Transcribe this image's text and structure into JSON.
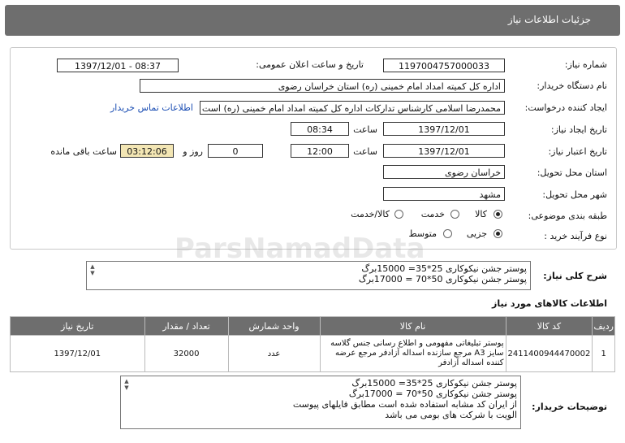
{
  "header": {
    "title": "جزئیات اطلاعات نیاز"
  },
  "form": {
    "need_number_label": "شماره نیاز:",
    "need_number": "1197004757000033",
    "announce_label": "تاریخ و ساعت اعلان عمومی:",
    "announce_value": "1397/12/01 - 08:37",
    "buyer_org_label": "نام دستگاه خریدار:",
    "buyer_org": "اداره کل کمیته امداد امام خمینی (ره) استان خراسان رضوی",
    "creator_label": "ایجاد کننده درخواست:",
    "creator": "محمدرضا اسلامی کارشناس تدارکات اداره کل کمیته امداد امام خمینی (ره) است",
    "contact_link": "اطلاعات تماس خریدار",
    "created_date_label": "تاریخ ایجاد نیاز:",
    "created_date": "1397/12/01",
    "time_label": "ساعت",
    "created_time": "08:34",
    "validity_label": "تاریخ اعتبار نیاز:",
    "validity_date": "1397/12/01",
    "validity_time": "12:00",
    "days_value": "0",
    "days_label": "روز و",
    "remaining_value": "03:12:06",
    "remaining_label": "ساعت باقی مانده",
    "delivery_place_label": "استان محل تحویل:",
    "delivery_place": "خراسان رضوی",
    "city_label": "شهر محل تحویل:",
    "city": "مشهد",
    "category_label": "طبقه بندی موضوعی:",
    "category_options": [
      "کالا",
      "خدمت",
      "کالا/خدمت"
    ],
    "process_label": "نوع فرآیند خرید :",
    "process_options": [
      "جزیی",
      "متوسط"
    ]
  },
  "summary": {
    "label": "شرح کلی نیاز:",
    "lines": [
      "پوستر جشن نیکوکاری  25*35= 15000برگ",
      "پوستر جشن نیکوکاری 50*70 = 17000برگ"
    ]
  },
  "goods": {
    "section_title": "اطلاعات کالاهای مورد نیاز",
    "columns": [
      "ردیف",
      "کد کالا",
      "نام کالا",
      "واحد شمارش",
      "تعداد / مقدار",
      "تاریخ نیاز"
    ],
    "rows": [
      {
        "row": "1",
        "code": "2411400944470002",
        "name": "پوستر تبلیغاتی مفهومی و اطلاع رسانی جنس گلاسه سایز A3 مرجع سازنده اسداله آزادفر مرجع عرضه کننده اسداله آزادفر",
        "unit": "عدد",
        "qty": "32000",
        "date": "1397/12/01"
      }
    ]
  },
  "buyer_notes": {
    "label": "توضیحات خریدار:",
    "lines": [
      "پوستر جشن نیکوکاری  25*35= 15000برگ",
      "پوستر جشن نیکوکاری 50*70 = 17000برگ",
      "از ایران کد مشابه استفاده شده است مطابق فایلهای پیوست",
      "الویت با شرکت های بومی  می باشد"
    ]
  }
}
